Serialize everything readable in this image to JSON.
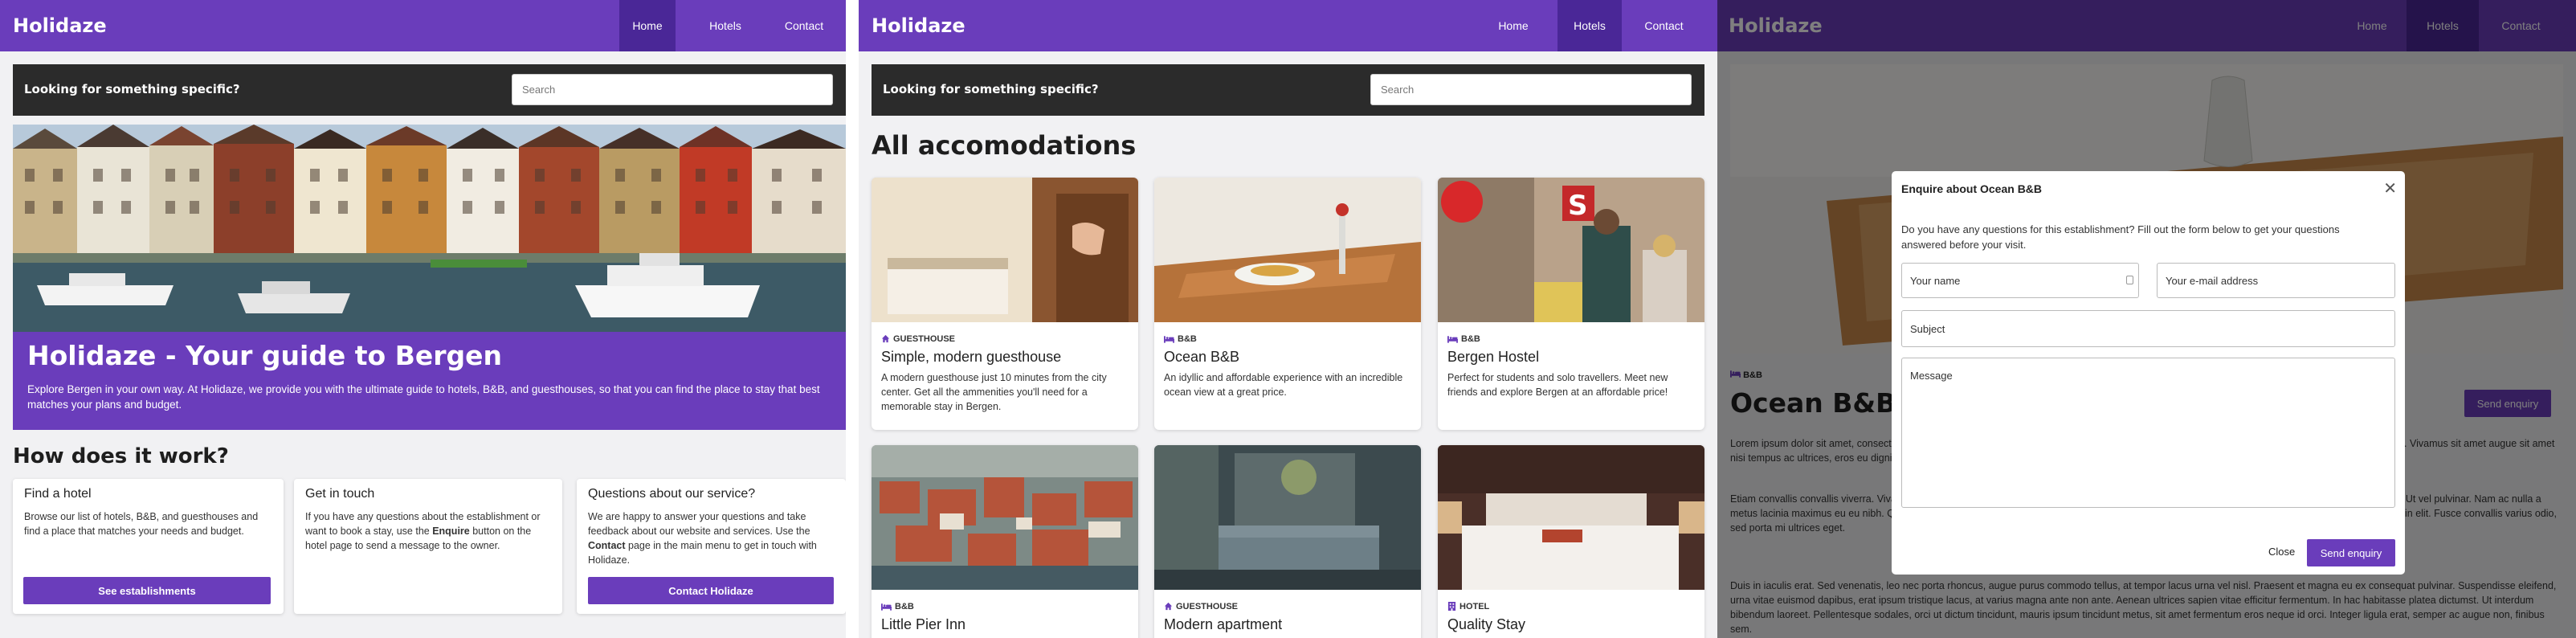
{
  "brand": {
    "logo": "Holidaze",
    "primary": "#6a3dbb",
    "primary_dark": "#4a2797"
  },
  "nav": {
    "home": "Home",
    "hotels": "Hotels",
    "contact": "Contact"
  },
  "search": {
    "label": "Looking for something specific?",
    "placeholder": "Search"
  },
  "home": {
    "hero_title": "Holidaze - Your guide to Bergen",
    "hero_text": "Explore Bergen in your own way. At Holidaze, we provide you with the ultimate guide to hotels, B&B, and guesthouses, so that you can find the place to stay that best matches your plans and budget.",
    "how_title": "How does it work?",
    "cards": [
      {
        "title": "Find a hotel",
        "text": "Browse our list of hotels, B&B, and guesthouses and find a place that matches your needs and budget.",
        "button": "See establishments"
      },
      {
        "title": "Get in touch",
        "text_a": "If you have any questions about the establishment or want to book a stay, use the ",
        "text_b": "Enquire",
        "text_c": " button on the hotel page to send a message to the owner."
      },
      {
        "title": "Questions about our service?",
        "text_a": "We are happy to answer your questions and take feedback about our website and services. Use the ",
        "text_b": "Contact",
        "text_c": " page in the main menu to get in touch with Holidaze.",
        "button": "Contact Holidaze"
      }
    ]
  },
  "hotels": {
    "title": "All accomodations",
    "items": [
      {
        "type": "GUESTHOUSE",
        "name": "Simple, modern guesthouse",
        "desc": "A modern guesthouse just 10 minutes from the city center. Get all the ammenities you'll need for a memorable stay in Bergen."
      },
      {
        "type": "B&B",
        "name": "Ocean B&B",
        "desc": "An idyllic and affordable experience with an incredible ocean view at a great price."
      },
      {
        "type": "B&B",
        "name": "Bergen Hostel",
        "desc": "Perfect for students and solo travellers. Meet new friends and explore Bergen at an affordable price!"
      },
      {
        "type": "B&B",
        "name": "Little Pier Inn",
        "desc": ""
      },
      {
        "type": "GUESTHOUSE",
        "name": "Modern apartment",
        "desc": ""
      },
      {
        "type": "HOTEL",
        "name": "Quality Stay",
        "desc": ""
      }
    ]
  },
  "detail": {
    "type": "B&B",
    "name": "Ocean B&B",
    "enquiry_button": "Send enquiry",
    "p1": "Lorem ipsum dolor sit amet, consectetur adipiscing elit. Vivamus sit amet augue sit amet nisi ultrices tempus. Praesent ac tortor, sed auctor ex ornare et. Vivamus sit amet augue sit amet nisi tempus ac ultrices, eros eu dignissim egestas. Fusce blandit varius mi a elementum.",
    "p2": "Etiam convallis convallis viverra. Vivamus nec ex arcu. Sed pretium nisi at tortor sodales. Proin ac pulvinar elit. Sed ullamcorper nibh ut congue efficitur. Ut vel pulvinar. Nam ac nulla a metus lacinia maximus eu eu nibh. Quisque sed nisi lobortis, cursus orci vitae, porttitor consequat. Maecenas faucibus rhoncus velit, ac auctor urna nisi in elit. Fusce convallis varius odio, sed porta mi ultrices eget.",
    "p3": "Duis in iaculis erat. Sed venenatis, leo nec porta rhoncus, augue purus commodo tellus, at tempor lacus urna vel nisl. Praesent et magna eu ex consequat pulvinar. Suspendisse eleifend, urna vitae euismod dapibus, erat ipsum tristique lacus, at varius magna ante non ante. Aenean ultrices sapien vitae efficitur fermentum. In hac habitasse platea dictumst. Ut interdum bibendum laoreet. Pellentesque sodales, orci ut dictum tincidunt, mauris ipsum tincidunt metus, sit amet fermentum eros neque id orci. Integer ligula erat, semper ac augue non, finibus sem."
  },
  "modal": {
    "title": "Enquire about Ocean B&B",
    "text": "Do you have any questions for this establishment? Fill out the form below to get your questions answered before your visit.",
    "name_ph": "Your name",
    "email_ph": "Your e-mail address",
    "subject_ph": "Subject",
    "message_ph": "Message",
    "close": "Close",
    "send": "Send enquiry"
  }
}
